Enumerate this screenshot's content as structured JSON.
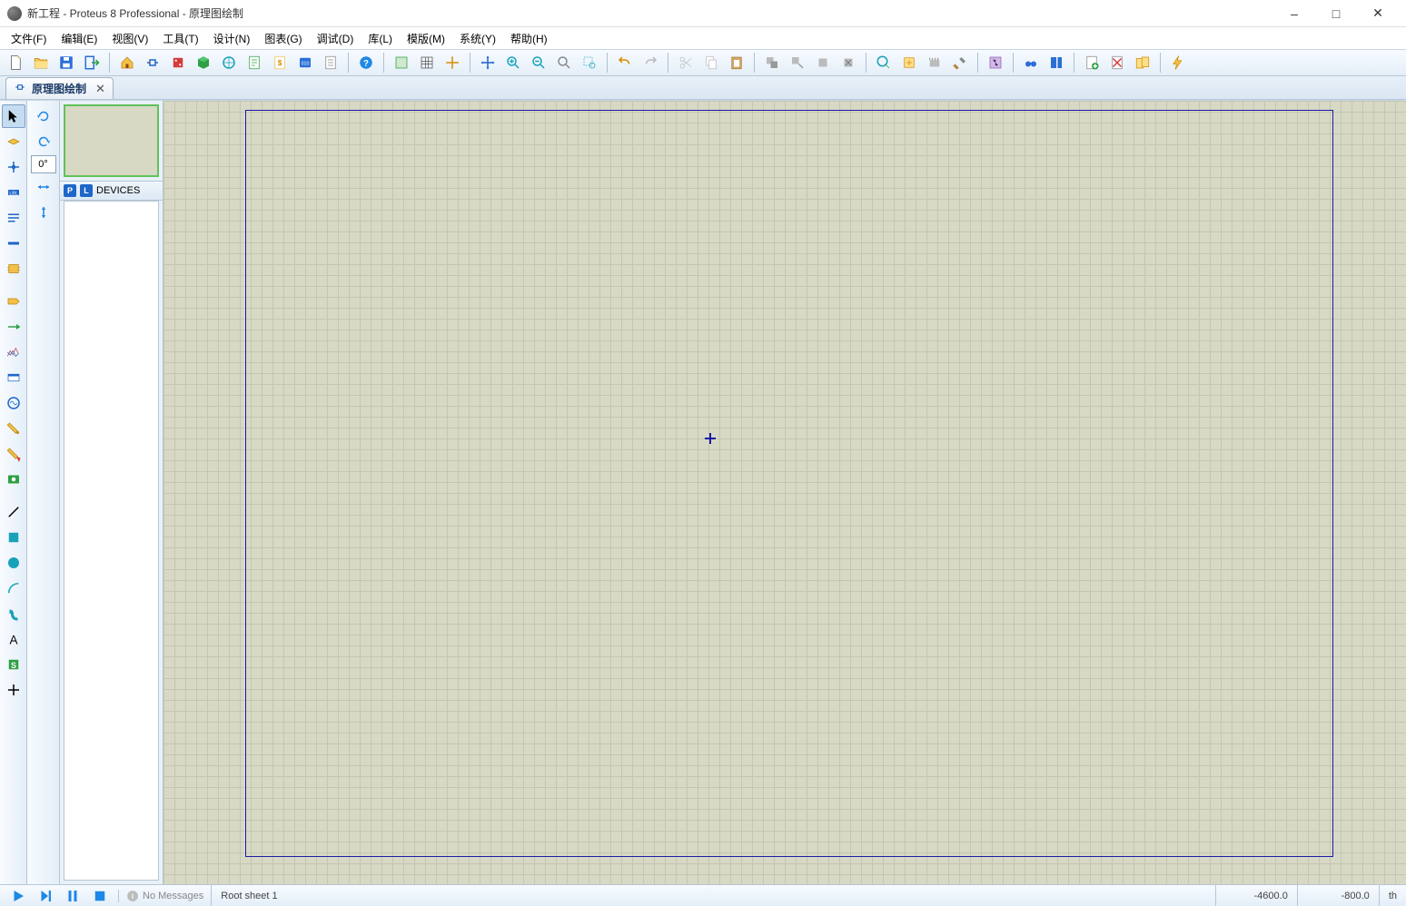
{
  "window": {
    "title": "新工程 - Proteus 8 Professional - 原理图绘制"
  },
  "menu": {
    "file": "文件(F)",
    "edit": "编辑(E)",
    "view": "视图(V)",
    "tool": "工具(T)",
    "design": "设计(N)",
    "chart": "图表(G)",
    "debug": "调试(D)",
    "library": "库(L)",
    "template": "模版(M)",
    "system": "系统(Y)",
    "help": "帮助(H)"
  },
  "tab": {
    "label": "原理图绘制"
  },
  "rotate": {
    "angle": "0°"
  },
  "devices": {
    "header": "DEVICES",
    "p": "P",
    "l": "L"
  },
  "status": {
    "no_messages": "No Messages",
    "sheet": "Root sheet 1",
    "coord_x": "-4600.0",
    "coord_y": "-800.0",
    "unit": "th"
  }
}
